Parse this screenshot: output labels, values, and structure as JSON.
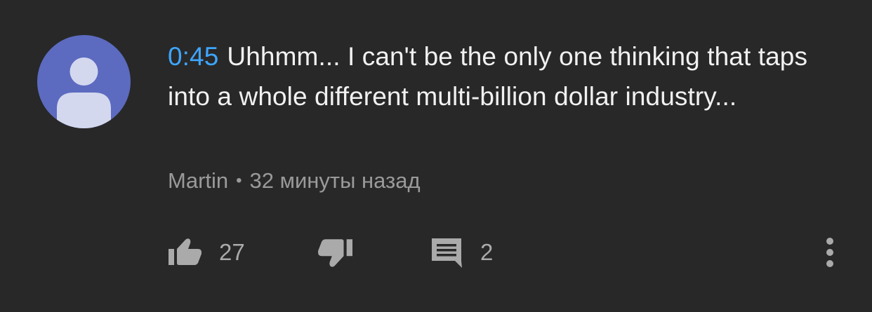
{
  "comment": {
    "timestamp": "0:45",
    "text": "Uhhmm... I can't be the only one thinking that taps into a whole different multi-billion dollar industry...",
    "author": "Martin",
    "separator": "•",
    "time_ago": "32 минуты назад"
  },
  "actions": {
    "like_count": "27",
    "reply_count": "2",
    "icons": [
      "thumbs-up-icon",
      "thumbs-down-icon",
      "comment-icon",
      "more-vert-icon"
    ]
  },
  "colors": {
    "background": "#282828",
    "text": "#f1f1f1",
    "secondary": "#9a9a9a",
    "link": "#3ea6ff",
    "avatar": "#5c6bc0"
  }
}
